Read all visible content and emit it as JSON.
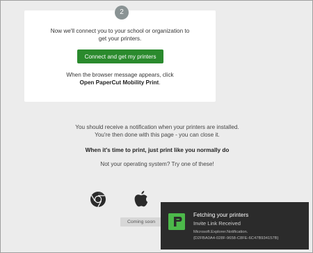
{
  "step": {
    "number": "2"
  },
  "card": {
    "line1": "Now we'll connect you to your school or organization to",
    "line2": "get your printers.",
    "connect_button": "Connect and get my printers",
    "browser_msg_line1": "When the browser message appears, click",
    "browser_msg_bold": "Open PaperCut Mobility Print",
    "browser_msg_end": "."
  },
  "info": {
    "notify_line1": "You should receive a notification when your printers are installed.",
    "notify_line2": "You're then done with this page - you can close it.",
    "print_tip": "When it's time to print, just print like you normally do",
    "os_prompt": "Not your operating system? Try one of these!"
  },
  "os": {
    "chrome": "chrome-icon",
    "apple": "apple-icon",
    "coming_soon": "Coming soon"
  },
  "notification": {
    "title": "Fetching your printers",
    "subtitle": "Invite Link Received",
    "detail_line1": "Microsoft.Explorer.Notification.",
    "detail_line2": "{D2FBA0A4-028F-9658-C8FE-6C47B934157B}"
  },
  "colors": {
    "accent_green": "#2a8a2d",
    "toast_bg": "#2b2b2b",
    "papercut_green": "#4cb84a",
    "page_bg": "#ececec"
  }
}
